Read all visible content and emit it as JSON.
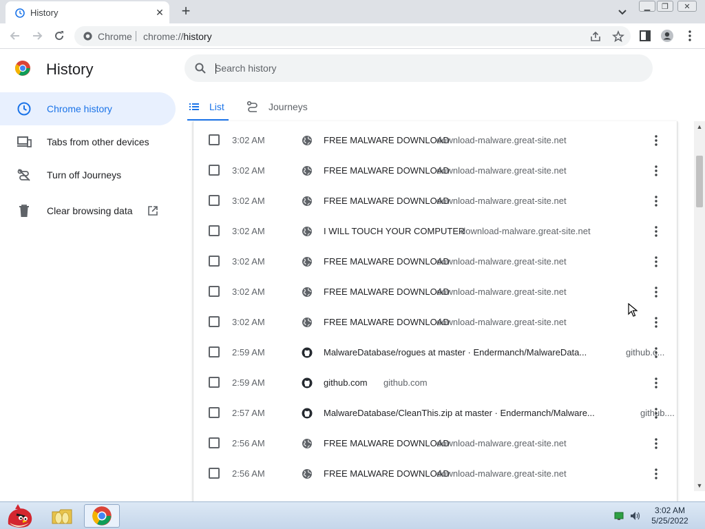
{
  "browser": {
    "tab_title": "History",
    "omnibox_label": "Chrome",
    "url_scheme": "chrome://",
    "url_path": "history"
  },
  "page": {
    "title": "History",
    "search_placeholder": "Search history",
    "tabs": [
      {
        "label": "List",
        "active": true
      },
      {
        "label": "Journeys",
        "active": false
      }
    ]
  },
  "sidebar": {
    "items": [
      {
        "label": "Chrome history",
        "icon": "clock-icon",
        "active": true
      },
      {
        "label": "Tabs from other devices",
        "icon": "devices-icon",
        "active": false
      },
      {
        "label": "Turn off Journeys",
        "icon": "journeys-off-icon",
        "active": false
      },
      {
        "label": "Clear browsing data",
        "icon": "trash-icon",
        "active": false,
        "external": true
      }
    ]
  },
  "history": [
    {
      "time": "3:02 AM",
      "title": "FREE MALWARE DOWNLOAD",
      "domain": "download-malware.great-site.net",
      "favicon": "globe-icon"
    },
    {
      "time": "3:02 AM",
      "title": "FREE MALWARE DOWNLOAD",
      "domain": "download-malware.great-site.net",
      "favicon": "globe-icon"
    },
    {
      "time": "3:02 AM",
      "title": "FREE MALWARE DOWNLOAD",
      "domain": "download-malware.great-site.net",
      "favicon": "globe-icon"
    },
    {
      "time": "3:02 AM",
      "title": "I WILL TOUCH YOUR COMPUTER",
      "domain": "download-malware.great-site.net",
      "favicon": "globe-icon"
    },
    {
      "time": "3:02 AM",
      "title": "FREE MALWARE DOWNLOAD",
      "domain": "download-malware.great-site.net",
      "favicon": "globe-icon"
    },
    {
      "time": "3:02 AM",
      "title": "FREE MALWARE DOWNLOAD",
      "domain": "download-malware.great-site.net",
      "favicon": "globe-icon"
    },
    {
      "time": "3:02 AM",
      "title": "FREE MALWARE DOWNLOAD",
      "domain": "download-malware.great-site.net",
      "favicon": "globe-icon"
    },
    {
      "time": "2:59 AM",
      "title": "MalwareDatabase/rogues at master · Endermanch/MalwareData...",
      "domain": "github.c...",
      "favicon": "github-icon"
    },
    {
      "time": "2:59 AM",
      "title": "github.com",
      "domain": "github.com",
      "favicon": "github-icon"
    },
    {
      "time": "2:57 AM",
      "title": "MalwareDatabase/CleanThis.zip at master · Endermanch/Malware...",
      "domain": "github....",
      "favicon": "github-icon"
    },
    {
      "time": "2:56 AM",
      "title": "FREE MALWARE DOWNLOAD",
      "domain": "download-malware.great-site.net",
      "favicon": "globe-icon"
    },
    {
      "time": "2:56 AM",
      "title": "FREE MALWARE DOWNLOAD",
      "domain": "download-malware.great-site.net",
      "favicon": "globe-icon"
    }
  ],
  "taskbar": {
    "clock_time": "3:02 AM",
    "clock_date": "5/25/2022",
    "apps": [
      "angry-birds-icon",
      "folder-icon",
      "chrome-icon"
    ]
  },
  "colors": {
    "accent": "#1a73e8",
    "active_nav_bg": "#e8f0fe",
    "tabstrip_bg": "#dee1e6"
  }
}
